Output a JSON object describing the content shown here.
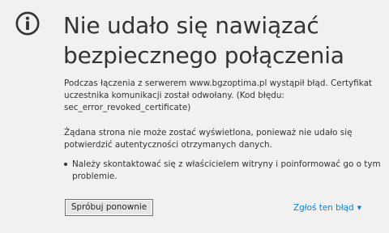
{
  "colors": {
    "background": "#f1f1f1",
    "text": "#333333",
    "link": "#0a84d9",
    "icon": "#333333"
  },
  "error": {
    "icon": "info-icon",
    "title_lines": [
      "Nie udało się nawiązać",
      "bezpiecznego połączenia"
    ],
    "description_lines": [
      "Podczas łączenia z serwerem www.bgzoptima.pl wystąpił błąd. Certyfikat",
      "uczestnika komunikacji został odwołany. (Kod błędu:",
      "sec_error_revoked_certificate)"
    ],
    "detail_lines": [
      "Żądana strona nie może zostać wyświetlona, ponieważ nie udało się",
      "potwierdzić autentyczności otrzymanych danych."
    ],
    "suggestions": [
      {
        "lines": [
          "Należy skontaktować się z właścicielem witryny i poinformować go o tym",
          "problemie."
        ]
      }
    ]
  },
  "actions": {
    "retry_label": "Spróbuj ponownie",
    "report_label": "Zgłoś ten błąd",
    "report_caret": "▼"
  }
}
